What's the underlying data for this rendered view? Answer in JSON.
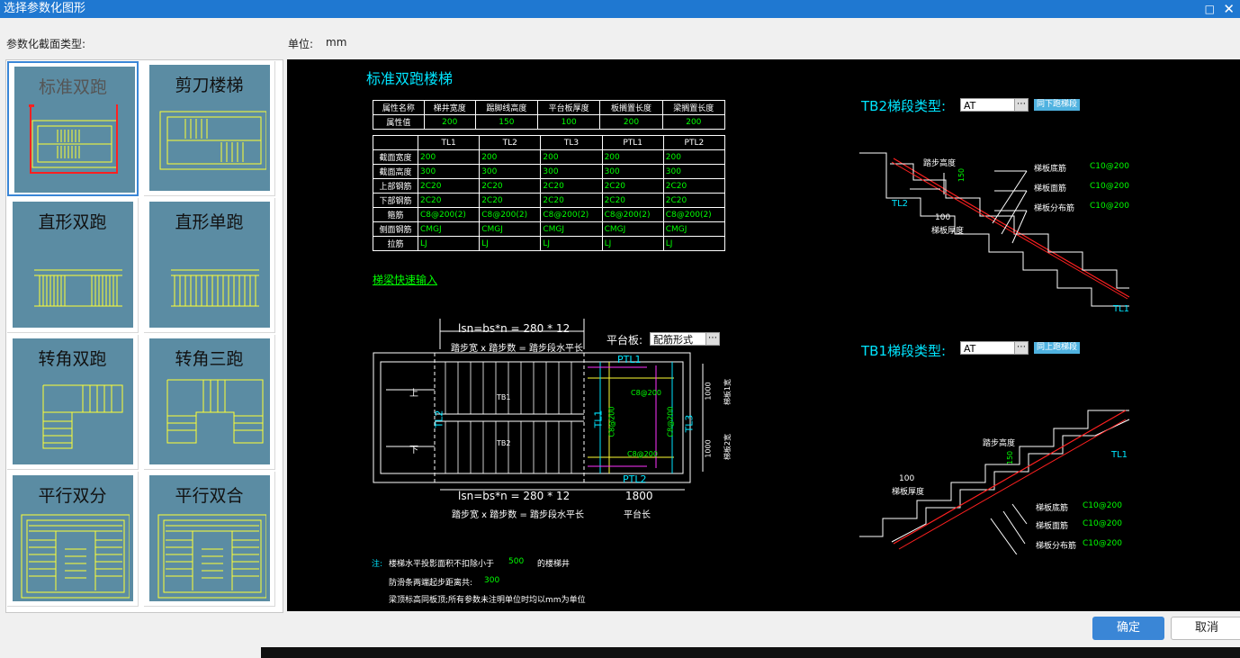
{
  "window": {
    "title": "选择参数化图形",
    "maximize_icon": "maximize-icon",
    "close_icon": "close-icon"
  },
  "labels": {
    "section_type": "参数化截面类型:",
    "unit_label": "单位:",
    "unit_value": "mm"
  },
  "thumbnails": [
    {
      "name": "标准双跑",
      "selected": true
    },
    {
      "name": "剪刀楼梯",
      "selected": false
    },
    {
      "name": "直形双跑",
      "selected": false
    },
    {
      "name": "直形单跑",
      "selected": false
    },
    {
      "name": "转角双跑",
      "selected": false
    },
    {
      "name": "转角三跑",
      "selected": false
    },
    {
      "name": "平行双分",
      "selected": false
    },
    {
      "name": "平行双合",
      "selected": false
    }
  ],
  "cad": {
    "title": "标准双跑楼梯",
    "props_headers": [
      "属性名称",
      "梯井宽度",
      "踢脚线高度",
      "平台板厚度",
      "板搁置长度",
      "梁搁置长度"
    ],
    "props_values": [
      "属性值",
      "200",
      "150",
      "100",
      "200",
      "200"
    ],
    "beam_headers": [
      "",
      "TL1",
      "TL2",
      "TL3",
      "PTL1",
      "PTL2"
    ],
    "beam_rows": [
      {
        "label": "截面宽度",
        "values": [
          "200",
          "200",
          "200",
          "200",
          "200"
        ]
      },
      {
        "label": "截面高度",
        "values": [
          "300",
          "300",
          "300",
          "300",
          "300"
        ]
      },
      {
        "label": "上部钢筋",
        "values": [
          "2C20",
          "2C20",
          "2C20",
          "2C20",
          "2C20"
        ]
      },
      {
        "label": "下部钢筋",
        "values": [
          "2C20",
          "2C20",
          "2C20",
          "2C20",
          "2C20"
        ]
      },
      {
        "label": "箍筋",
        "values": [
          "C8@200(2)",
          "C8@200(2)",
          "C8@200(2)",
          "C8@200(2)",
          "C8@200(2)"
        ]
      },
      {
        "label": "侧面钢筋",
        "values": [
          "CMGJ",
          "CMGJ",
          "CMGJ",
          "CMGJ",
          "CMGJ"
        ]
      },
      {
        "label": "拉筋",
        "values": [
          "LJ",
          "LJ",
          "LJ",
          "LJ",
          "LJ"
        ]
      }
    ],
    "quick_input": "梯梁快速输入",
    "plan": {
      "formula_top": "lsn=bs*n = 280 * 12",
      "formula_top_note": "踏步宽 x 踏步数 = 踏步段水平长",
      "formula_bottom": "lsn=bs*n = 280 * 12",
      "formula_bottom_note": "踏步宽 x 踏步数 = 踏步段水平长",
      "platform_label": "平台板:",
      "platform_value": "配筋形式",
      "up": "上",
      "down": "下",
      "tb1": "TB1",
      "tb2": "TB2",
      "tl1": "TL1",
      "tl2": "TL2",
      "tl3": "TL3",
      "ptl1": "PTL1",
      "ptl2": "PTL2",
      "c8_top": "C8@200",
      "c8_bottom": "C8@200",
      "c8_left": "C8@200",
      "c8_right": "C8@200",
      "dim_1000a": "1000",
      "dim_1000b": "1000",
      "dim_width1": "梯板1宽",
      "dim_width2": "梯板2宽",
      "dim_1800": "1800",
      "platform_len": "平台长"
    },
    "tb2": {
      "label": "TB2梯段类型:",
      "type_value": "AT",
      "button": "同下跑梯段",
      "step_height": "踏步高度",
      "v150": "150",
      "v100": "100",
      "thickness": "梯板厚度",
      "bottom_bar": "梯板底筋",
      "top_bar": "梯板面筋",
      "dist_bar": "梯板分布筋",
      "bar_value": "C10@200",
      "tl2": "TL2",
      "tl1": "TL1"
    },
    "tb1": {
      "label": "TB1梯段类型:",
      "type_value": "AT",
      "button": "同上跑梯段",
      "step_height": "踏步高度",
      "v150": "150",
      "v100": "100",
      "thickness": "梯板厚度",
      "bottom_bar": "梯板底筋",
      "top_bar": "梯板面筋",
      "dist_bar": "梯板分布筋",
      "bar_value": "C10@200",
      "tl1": "TL1"
    },
    "notes": {
      "prefix": "注:",
      "line1a": "楼梯水平投影面积不扣除小于",
      "line1b": "500",
      "line1c": "的楼梯井",
      "line2a": "防滑条两端起步距离共:",
      "line2b": "300",
      "line3": "梁顶标高同板顶;所有参数未注明单位时均以mm为单位"
    }
  },
  "buttons": {
    "ok": "确定",
    "cancel": "取消"
  }
}
